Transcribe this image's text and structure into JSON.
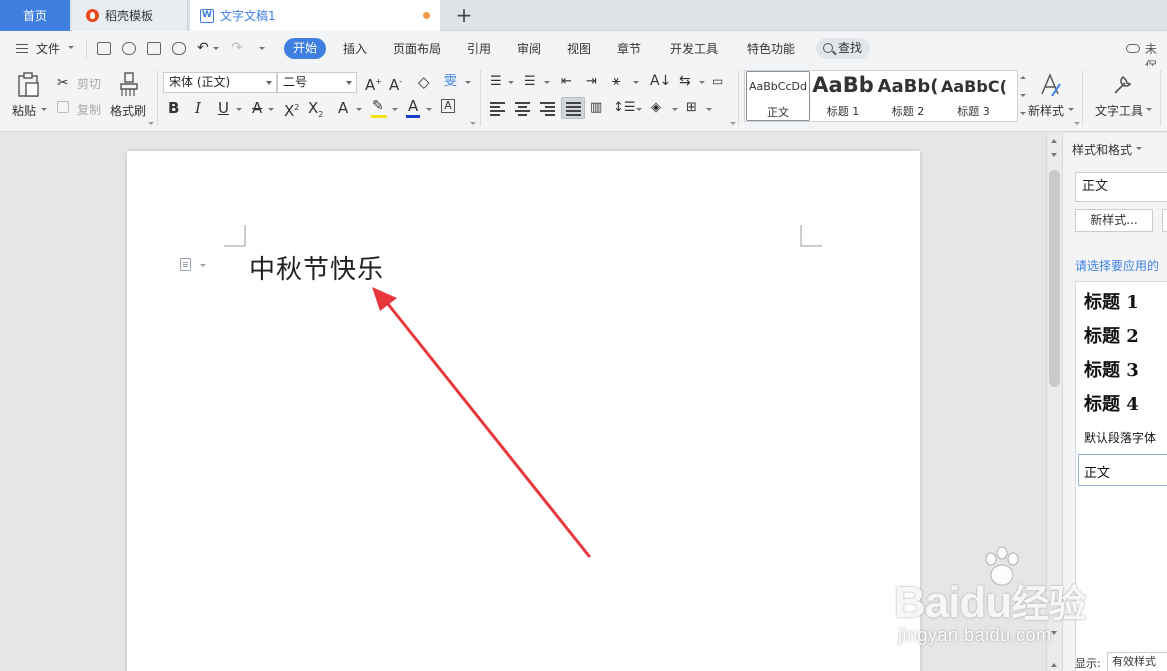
{
  "tabs": {
    "home": "首页",
    "template": "稻壳模板",
    "document": "文字文稿1",
    "new_tab_icon": "plus-icon"
  },
  "menu": {
    "file": "文件",
    "active": "开始",
    "items": [
      "插入",
      "页面布局",
      "引用",
      "审阅",
      "视图",
      "章节",
      "开发工具",
      "特色功能"
    ],
    "search": "查找",
    "cloud_status": "未保"
  },
  "ribbon": {
    "paste": "粘贴",
    "cut": "剪切",
    "copy": "复制",
    "format_painter": "格式刷",
    "font_name": "宋体 (正文)",
    "font_size": "二号",
    "bold": "B",
    "italic": "I",
    "underline": "U",
    "styles": [
      {
        "sample": "AaBbCcDd",
        "name": "正文"
      },
      {
        "sample": "AaBb",
        "name": "标题 1"
      },
      {
        "sample": "AaBb(",
        "name": "标题 2"
      },
      {
        "sample": "AaBbC(",
        "name": "标题 3"
      }
    ],
    "new_style": "新样式",
    "text_tools": "文字工具"
  },
  "document": {
    "text": "中秋节快乐"
  },
  "annotation": {
    "arrow_color": "#e8383d"
  },
  "side_panel": {
    "title": "样式和格式",
    "current_style": "正文",
    "new_style_button": "新样式...",
    "hint": "请选择要应用的",
    "styles": [
      "标题 1",
      "标题 2",
      "标题 3",
      "标题 4",
      "默认段落字体",
      "正文"
    ],
    "show_label": "显示:",
    "show_value": "有效样式"
  },
  "watermark": {
    "brand": "Bai",
    "brand2": "du",
    "brand_cn": "经验",
    "url": "jingyan.baidu.com"
  },
  "colors": {
    "accent": "#3f7fdf",
    "tab_dot": "#f29a4a",
    "font_color_bar": "#1a3fcf",
    "highlight_bar": "#f5e21a"
  }
}
